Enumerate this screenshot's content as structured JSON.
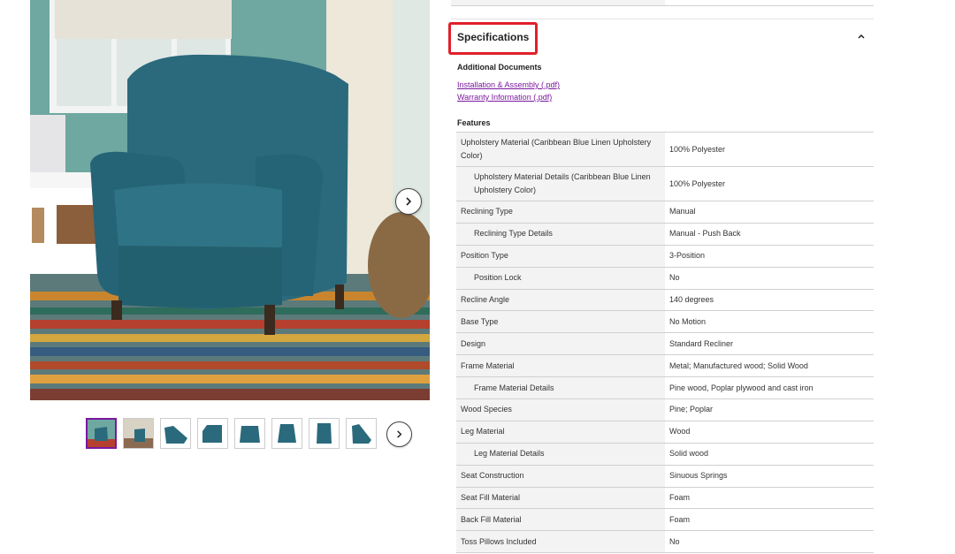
{
  "gallery": {
    "hero_alt": "Recliner in Caribbean Blue Linen",
    "next_icon": "chevron-right-icon",
    "thumb_count": 8,
    "thumbs_next_icon": "chevron-right-icon"
  },
  "specs": {
    "title": "Specifications",
    "collapse_icon": "chevron-up-icon",
    "additional_documents_label": "Additional Documents",
    "documents": [
      "Installation & Assembly (.pdf)",
      "Warranty Information (.pdf)"
    ],
    "features_label": "Features",
    "rows": [
      {
        "label": "Upholstery Material (Caribbean Blue Linen Upholstery Color)",
        "value": "100% Polyester"
      },
      {
        "label": "Upholstery Material Details (Caribbean Blue Linen Upholstery Color)",
        "value": "100% Polyester"
      },
      {
        "label": "Reclining Type",
        "value": "Manual"
      },
      {
        "label": "Reclining Type Details",
        "value": "Manual - Push Back"
      },
      {
        "label": "Position Type",
        "value": "3-Position"
      },
      {
        "label": "Position Lock",
        "value": "No"
      },
      {
        "label": "Recline Angle",
        "value": "140 degrees"
      },
      {
        "label": "Base Type",
        "value": "No Motion"
      },
      {
        "label": "Design",
        "value": "Standard Recliner"
      },
      {
        "label": "Frame Material",
        "value": "Metal; Manufactured wood; Solid Wood"
      },
      {
        "label": "Frame Material Details",
        "value": "Pine wood, Poplar plywood and cast iron"
      },
      {
        "label": "Wood Species",
        "value": "Pine; Poplar"
      },
      {
        "label": "Leg Material",
        "value": "Wood"
      },
      {
        "label": "Leg Material Details",
        "value": "Solid wood"
      },
      {
        "label": "Seat Construction",
        "value": "Sinuous Springs"
      },
      {
        "label": "Seat Fill Material",
        "value": "Foam"
      },
      {
        "label": "Back Fill Material",
        "value": "Foam"
      },
      {
        "label": "Toss Pillows Included",
        "value": "No"
      }
    ]
  },
  "colors": {
    "highlight_border": "#e0202a",
    "link": "#7b189f",
    "label_cell_bg": "#f3f3f3",
    "chair_teal": "#2a6a7c"
  }
}
